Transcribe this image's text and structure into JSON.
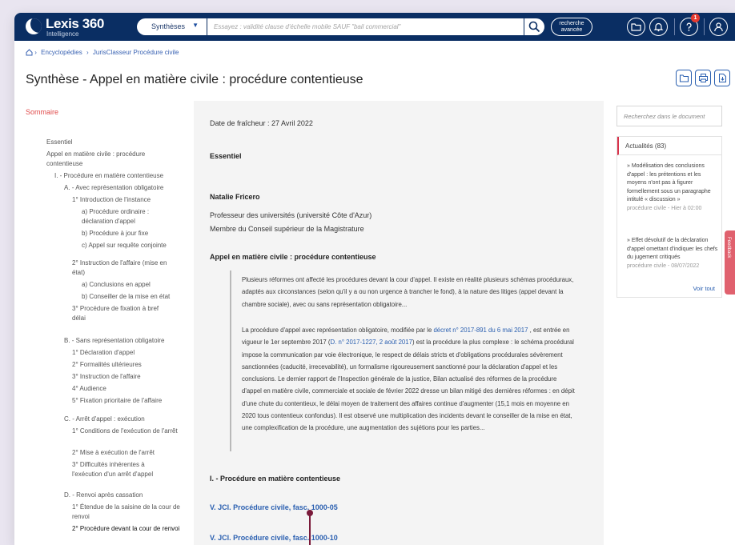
{
  "app": {
    "brand": "Lexis 360",
    "brand_sub": "Intelligence"
  },
  "search": {
    "scope": "Synthèses",
    "placeholder": "Essayez : validité clause d'échelle mobile SAUF \"bail commercial\"",
    "advanced_label": "recherche avancée"
  },
  "header": {
    "notification_count": "1",
    "icons": [
      "folder-icon",
      "bell-icon",
      "help-icon",
      "user-icon"
    ]
  },
  "breadcrumb": [
    "Encyclopédies",
    "JurisClasseur Procédure civile"
  ],
  "page": {
    "title": "Synthèse - Appel en matière civile : procédure contentieuse",
    "tools": [
      "folder-icon",
      "print-icon",
      "download-icon"
    ]
  },
  "sommaire": {
    "title": "Sommaire",
    "items": [
      {
        "label": "Essentiel"
      },
      {
        "label": "Appel en matière civile : procédure contentieuse"
      },
      {
        "label": "I. - Procédure en matière contentieuse"
      },
      {
        "label": "A. - Avec représentation obligatoire"
      },
      {
        "label": "1° Introduction de l'instance"
      },
      {
        "label": "a) Procédure ordinaire : déclaration d'appel"
      },
      {
        "label": "b) Procédure à jour fixe"
      },
      {
        "label": "c) Appel sur requête conjointe"
      },
      {
        "label": "2° Instruction de l'affaire (mise en état)"
      },
      {
        "label": "a) Conclusions en appel"
      },
      {
        "label": "b) Conseiller de la mise en état"
      },
      {
        "label": "3° Procédure de fixation à bref délai"
      },
      {
        "label": "B. - Sans représentation obligatoire"
      },
      {
        "label": "1° Déclaration d'appel"
      },
      {
        "label": "2° Formalités ultérieures"
      },
      {
        "label": "3° Instruction de l'affaire"
      },
      {
        "label": "4° Audience"
      },
      {
        "label": "5° Fixation prioritaire de l'affaire"
      },
      {
        "label": "C. - Arrêt d'appel : exécution"
      },
      {
        "label": "1° Conditions de l'exécution de l'arrêt"
      },
      {
        "label": "2° Mise à exécution de l'arrêt"
      },
      {
        "label": "3° Difficultés inhérentes à l'exécution d'un arrêt d'appel"
      },
      {
        "label": "D. - Renvoi après cassation"
      },
      {
        "label": "1° Étendue de la saisine de la cour de renvoi"
      },
      {
        "label": "2° Procédure devant la cour de renvoi"
      }
    ]
  },
  "content": {
    "freshness": "Date de fraîcheur : 27 Avril 2022",
    "essentiel": "Essentiel",
    "author": "Natalie Fricero",
    "author_role_1": "Professeur des universités (université Côte d'Azur)",
    "author_role_2": "Membre du Conseil supérieur de la Magistrature",
    "section_title": "Appel en matière civile : procédure contentieuse",
    "quote_p1": "Plusieurs réformes ont affecté les procédures devant la cour d'appel. Il existe en réalité plusieurs schémas procéduraux, adaptés aux circonstances (selon qu'il y a ou non urgence à trancher le fond), à la nature des litiges (appel devant la chambre sociale), avec ou sans représentation obligatoire...",
    "quote_p2_a": "La procédure d'appel avec représentation obligatoire, modifiée par le ",
    "quote_p2_link1": "décret n° 2017-891 du 6 mai 2017",
    "quote_p2_b": " , est entrée en vigueur le 1er septembre 2017 (",
    "quote_p2_link2": "D. n° 2017-1227, 2 août 2017",
    "quote_p2_c": ") est la procédure la plus complexe : le schéma procédural impose la communication par voie électronique, le respect de délais stricts et d'obligations procédurales sévèrement sanctionnées (caducité, irrecevabilité), un formalisme rigoureusement sanctionné pour la déclaration d'appel et les conclusions. Le dernier rapport de l'Inspection générale de la justice, Bilan actualisé des réformes de la procédure d'appel en matière civile, commerciale et sociale de février 2022 dresse un bilan mitigé des dernières réformes : en dépit d'une chute du contentieux, le délai moyen de traitement des affaires continue d'augmenter (15,1 mois en moyenne en 2020 tous contentieux confondus). Il est observé une multiplication des incidents devant le conseiller de la mise en état, une complexification de la procédure, une augmentation des sujétions pour les parties...",
    "part_title": "I. - Procédure en matière contentieuse",
    "link_1": "V. JCl. Procédure civile, fasc. 1000-05",
    "link_2": "V. JCl. Procédure civile, fasc. 1000-10"
  },
  "right_panel": {
    "search_placeholder": "Recherchez dans le document",
    "news_title": "Actualités (83)",
    "news": [
      {
        "text": "» Modélisation des conclusions d'appel : les prétentions et les moyens n'ont pas à figurer formellement sous un paragraphe intitulé « discussion »",
        "meta": "procédure civile - Hier à 02:00"
      },
      {
        "text": "» Effet dévolutif de la déclaration d'appel omettant d'indiquer les chefs du jugement critiqués",
        "meta": "procédure civile - 08/07/2022"
      }
    ],
    "see_all": "Voir tout"
  },
  "side_tab": {
    "label": "Feedback"
  },
  "colors": {
    "nav": "#0a2e63",
    "accent_red": "#d8344c",
    "link": "#2a5fb0"
  }
}
